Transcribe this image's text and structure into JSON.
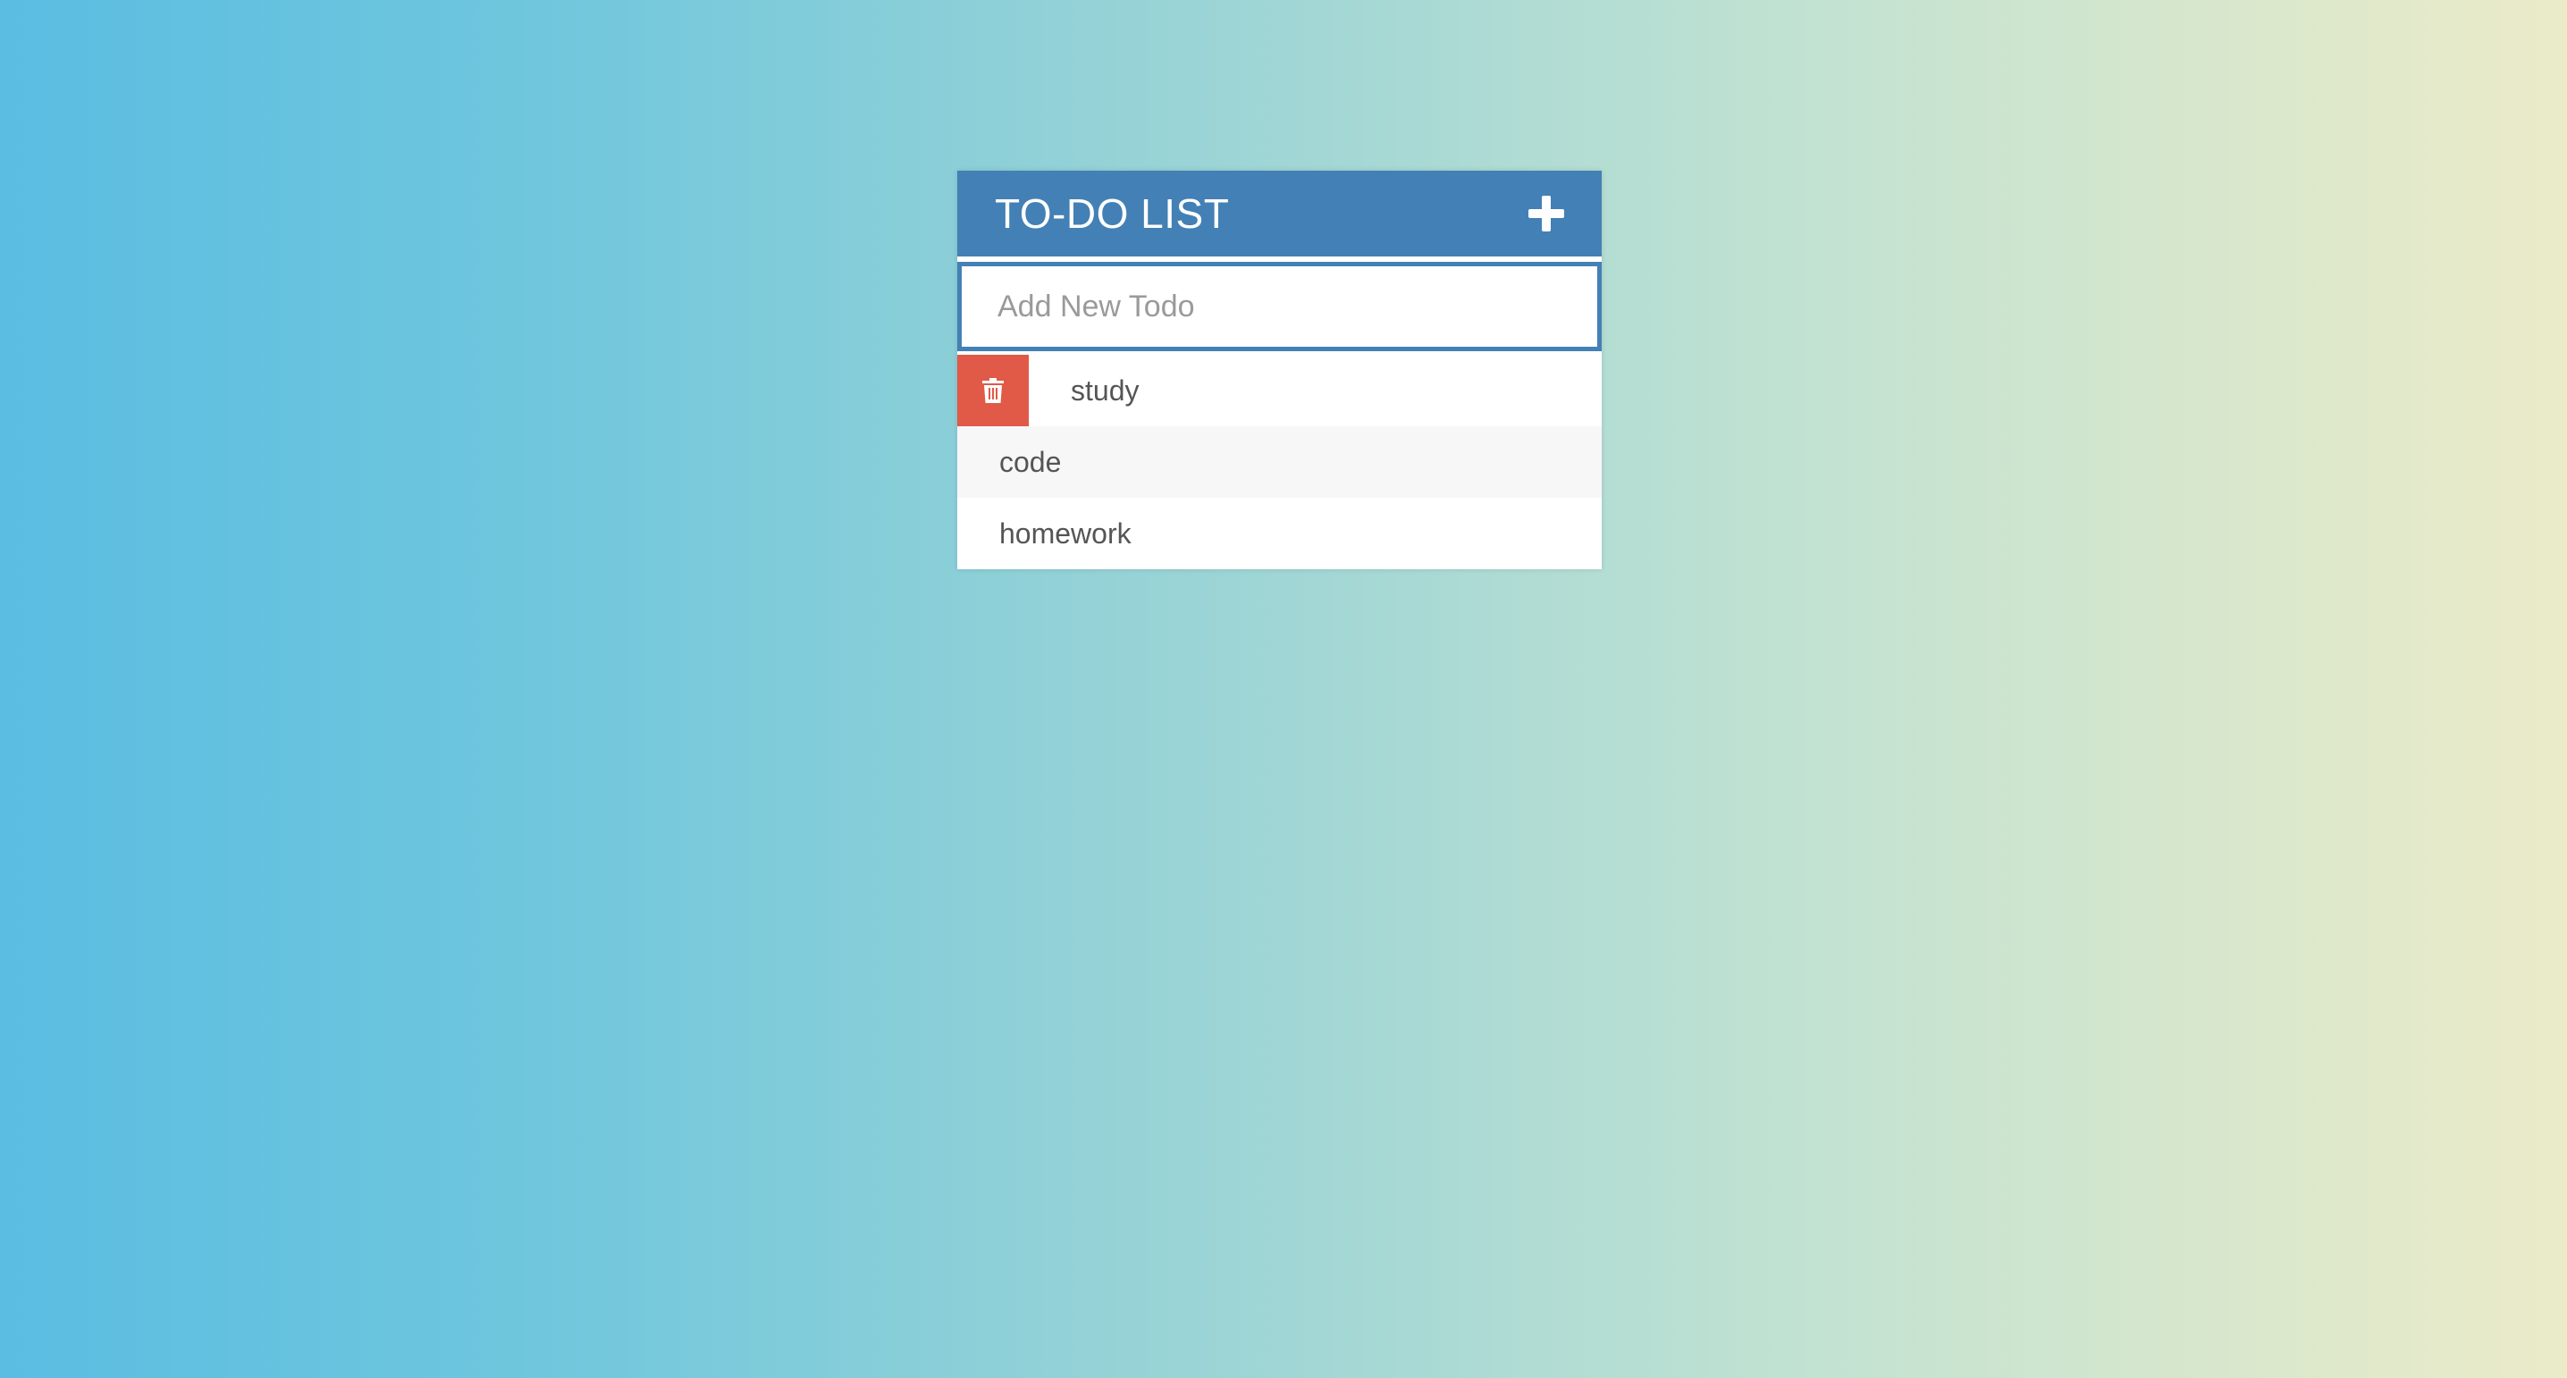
{
  "app": {
    "title": "TO-DO LIST"
  },
  "input": {
    "placeholder": "Add New Todo",
    "value": ""
  },
  "todos": [
    {
      "text": "study",
      "showing_delete": true
    },
    {
      "text": "code",
      "showing_delete": false
    },
    {
      "text": "homework",
      "showing_delete": false
    }
  ],
  "colors": {
    "header": "#4380b5",
    "delete": "#e05a47"
  },
  "icons": {
    "add": "plus-icon",
    "delete": "trash-icon"
  }
}
